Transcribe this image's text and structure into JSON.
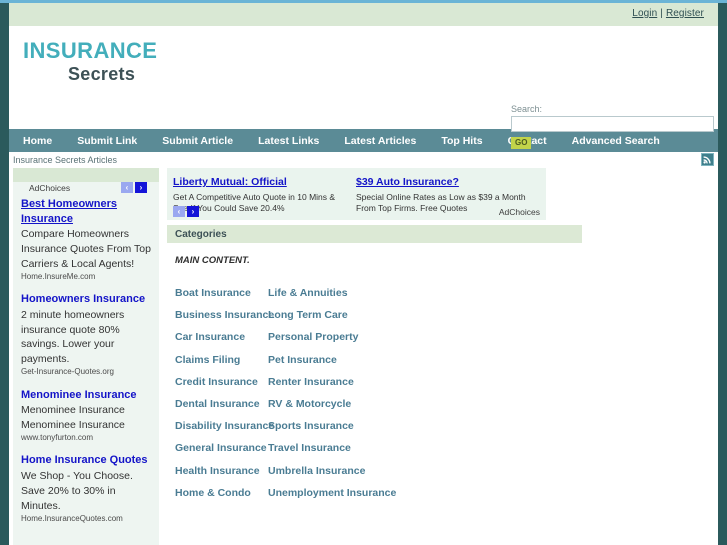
{
  "site": {
    "logo_line1": "INSURANCE",
    "logo_line2": "Secrets",
    "breadcrumb": "Insurance Secrets Articles",
    "rss_icon": "rss-icon"
  },
  "topbar": {
    "login": "Login",
    "separator": "|",
    "register": "Register"
  },
  "search": {
    "label": "Search:",
    "value": "",
    "placeholder": "",
    "go_label": "GO"
  },
  "nav": {
    "items": [
      {
        "label": "Home"
      },
      {
        "label": "Submit Link"
      },
      {
        "label": "Submit Article"
      },
      {
        "label": "Latest Links"
      },
      {
        "label": "Latest Articles"
      },
      {
        "label": "Top Hits"
      },
      {
        "label": "Contact"
      },
      {
        "label": "Advanced Search"
      }
    ]
  },
  "banner_ad": {
    "adchoices": "AdChoices",
    "prev_arrow": "‹",
    "next_arrow": "›",
    "ads": [
      {
        "title": "Liberty Mutual: Official",
        "desc": "Get A Competitive Auto Quote in 10 Mins & See If You Could Save 20.4%"
      },
      {
        "title": "$39 Auto Insurance?",
        "desc": "Special Online Rates as Low as $39 a Month From Top Firms. Free Quotes"
      }
    ]
  },
  "sidebar_ads": {
    "adchoices": "AdChoices",
    "prev_arrow": "‹",
    "next_arrow": "›",
    "ads": [
      {
        "title": "Best Homeowners Insurance",
        "desc": "Compare Homeowners Insurance Quotes From Top Carriers & Local Agents!",
        "url": "Home.InsureMe.com"
      },
      {
        "title": "Homeowners Insurance",
        "desc": "2 minute homeowners insurance quote 80% savings. Lower your payments.",
        "url": "Get-Insurance-Quotes.org"
      },
      {
        "title": "Menominee Insurance",
        "desc": "Menominee Insurance Menominee Insurance",
        "url": "www.tonyfurton.com"
      },
      {
        "title": "Home Insurance Quotes",
        "desc": "We Shop - You Choose. Save 20% to 30% in Minutes.",
        "url": "Home.InsuranceQuotes.com"
      }
    ]
  },
  "main": {
    "categories_header": "Categories",
    "content_note": "MAIN CONTENT.",
    "categories": [
      {
        "left": "Boat Insurance",
        "right": "Life & Annuities"
      },
      {
        "left": "Business Insurance",
        "right": "Long Term Care"
      },
      {
        "left": "Car Insurance",
        "right": "Personal Property"
      },
      {
        "left": "Claims Filing",
        "right": "Pet Insurance"
      },
      {
        "left": "Credit Insurance",
        "right": "Renter Insurance"
      },
      {
        "left": "Dental Insurance",
        "right": "RV & Motorcycle"
      },
      {
        "left": "Disability Insurance",
        "right": "Sports Insurance"
      },
      {
        "left": "General Insurance",
        "right": "Travel Insurance"
      },
      {
        "left": "Health Insurance",
        "right": "Umbrella Insurance"
      },
      {
        "left": "Home & Condo",
        "right": "Unemployment Insurance"
      }
    ]
  },
  "colors": {
    "frame": "#2b5a5c",
    "top_edge": "#6bb4d6",
    "topbar_bg": "#d9e8d4",
    "nav_bg": "#5b8b96",
    "logo_primary": "#43aebb",
    "logo_secondary": "#3d5156",
    "go_button": "#c2d44a",
    "ad_link": "#1414c8",
    "category_link": "#4a7c93",
    "panel_header": "#dce9d5",
    "sidebar_bg": "#eef5f1"
  }
}
